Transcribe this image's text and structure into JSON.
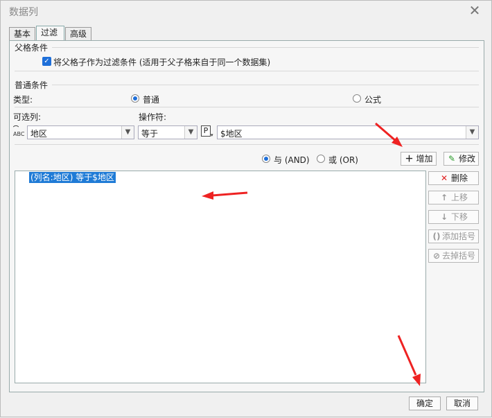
{
  "window": {
    "title": "数据列"
  },
  "tabs": [
    {
      "label": "基本"
    },
    {
      "label": "过滤"
    },
    {
      "label": "高级"
    }
  ],
  "parent_condition": {
    "group_title": "父格条件",
    "checkbox_label": "将父格子作为过滤条件 (适用于父子格来自于同一个数据集)",
    "checked": true
  },
  "normal_condition": {
    "group_title": "普通条件",
    "type_label": "类型:",
    "type_options": [
      {
        "label": "普通",
        "selected": true
      },
      {
        "label": "公式",
        "selected": false
      }
    ],
    "column_label": "可选列:",
    "operator_label": "操作符:",
    "column_value": "地区",
    "operator_value": "等于",
    "param_icon": "P",
    "param_value": "$地区"
  },
  "logic": {
    "and_label": "与 (AND)",
    "or_label": "或 (OR)",
    "selected": "and",
    "add_label": "增加",
    "modify_label": "修改"
  },
  "conditions": [
    "(列名:地区) 等于$地区"
  ],
  "side_buttons": {
    "delete": "删除",
    "up": "上移",
    "down": "下移",
    "add_paren": "添加括号",
    "remove_paren": "去掉括号"
  },
  "footer": {
    "ok": "确定",
    "cancel": "取消"
  },
  "colors": {
    "accent": "#1e6fd9",
    "selection": "#1f7bd6",
    "annotation": "#ee2222"
  }
}
